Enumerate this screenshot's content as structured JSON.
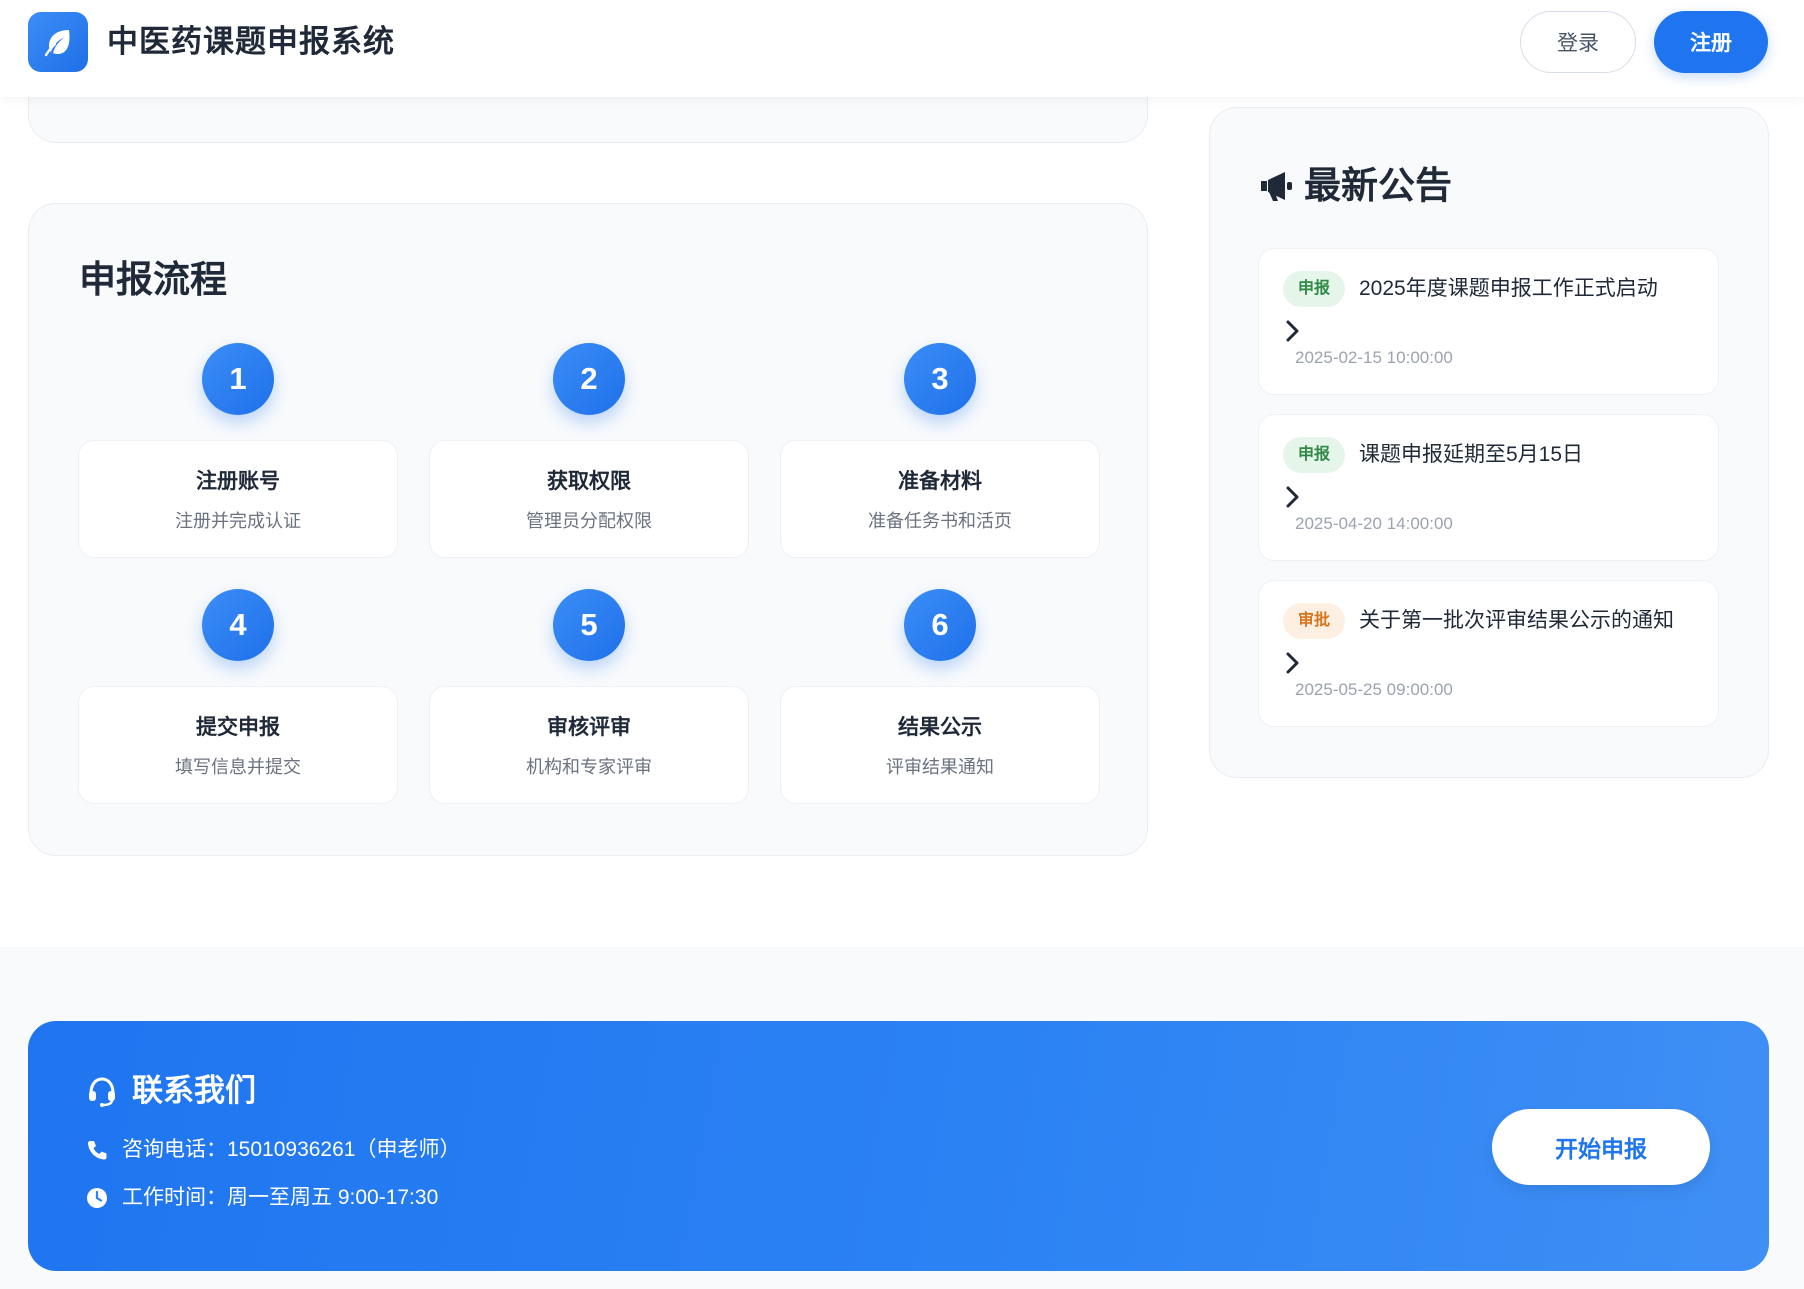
{
  "header": {
    "app_title": "中医药课题申报系统",
    "login_label": "登录",
    "register_label": "注册"
  },
  "process": {
    "title": "申报流程",
    "steps": [
      {
        "num": "1",
        "name": "注册账号",
        "desc": "注册并完成认证"
      },
      {
        "num": "2",
        "name": "获取权限",
        "desc": "管理员分配权限"
      },
      {
        "num": "3",
        "name": "准备材料",
        "desc": "准备任务书和活页"
      },
      {
        "num": "4",
        "name": "提交申报",
        "desc": "填写信息并提交"
      },
      {
        "num": "5",
        "name": "审核评审",
        "desc": "机构和专家评审"
      },
      {
        "num": "6",
        "name": "结果公示",
        "desc": "评审结果通知"
      }
    ]
  },
  "notices": {
    "title": "最新公告",
    "items": [
      {
        "tag": "申报",
        "tag_color": "#2f8a46",
        "text": "2025年度课题申报工作正式启动",
        "date": "2025-02-15 10:00:00"
      },
      {
        "tag": "申报",
        "tag_color": "#2f8a46",
        "text": "课题申报延期至5月15日",
        "date": "2025-04-20 14:00:00"
      },
      {
        "tag": "审批",
        "tag_color": "#d9731c",
        "text": "关于第一批次评审结果公示的通知",
        "date": "2025-05-25 09:00:00"
      }
    ]
  },
  "contact": {
    "title": "联系我们",
    "phone": "咨询电话：15010936261（申老师）",
    "hours": "工作时间：周一至周五 9:00-17:30",
    "start_label": "开始申报"
  },
  "colors": {
    "primary": "#1f75f0",
    "background": "#f8fafc",
    "text": "#1f2937"
  }
}
